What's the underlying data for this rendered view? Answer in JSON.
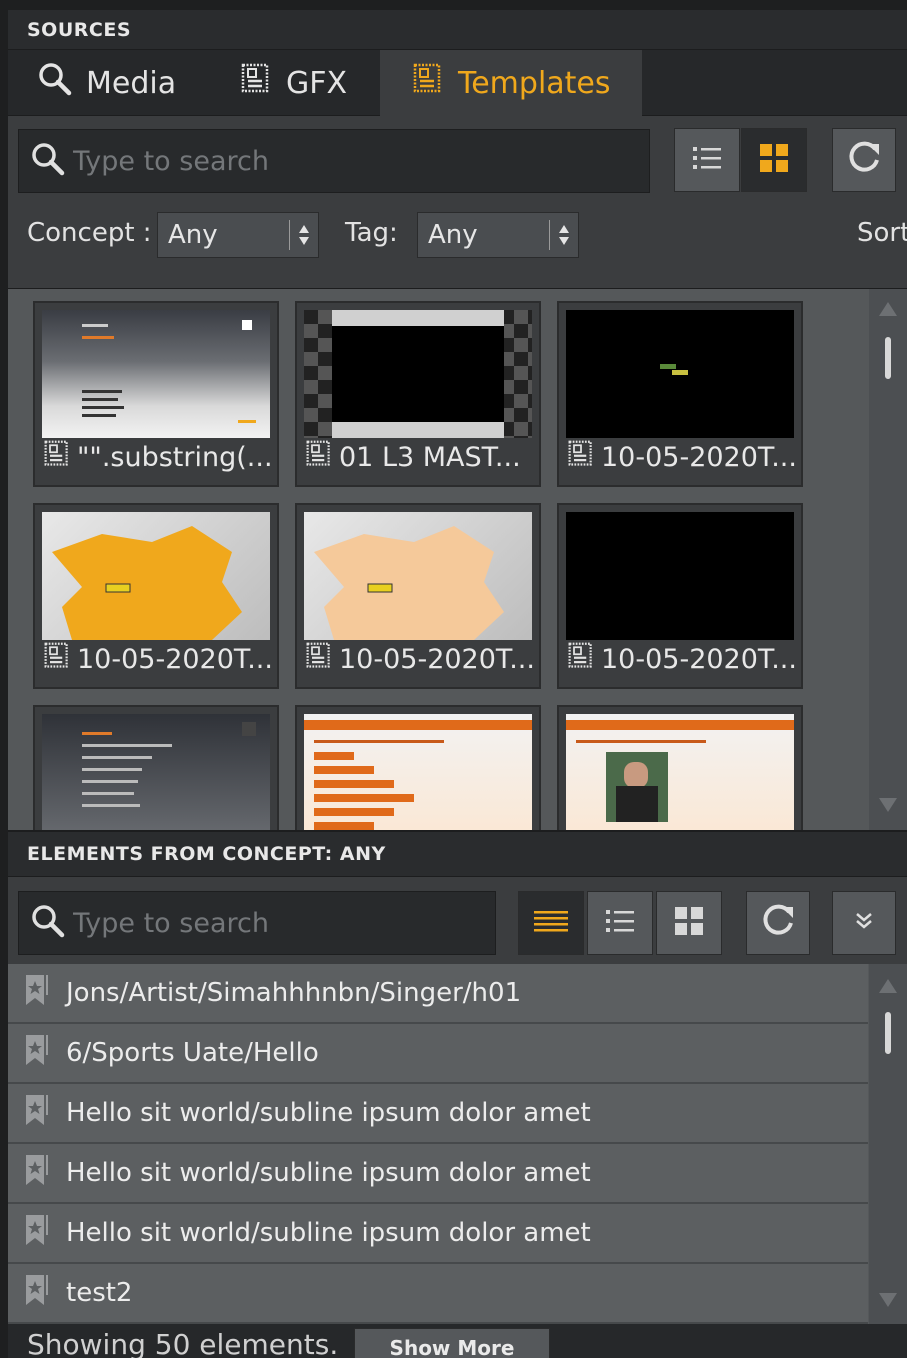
{
  "sources": {
    "header": "SOURCES",
    "tabs": [
      {
        "label": "Media",
        "icon": "search-icon"
      },
      {
        "label": "GFX",
        "icon": "gfx-icon"
      },
      {
        "label": "Templates",
        "icon": "template-icon",
        "active": true
      }
    ],
    "search_placeholder": "Type to search",
    "concept_label": "Concept :",
    "concept_value": "Any",
    "tag_label": "Tag:",
    "tag_value": "Any",
    "sort_label": "Sort",
    "templates": [
      {
        "caption": "\"\".substring(..."
      },
      {
        "caption": "01 L3 MAST..."
      },
      {
        "caption": "10-05-2020T..."
      },
      {
        "caption": "10-05-2020T..."
      },
      {
        "caption": "10-05-2020T..."
      },
      {
        "caption": "10-05-2020T..."
      },
      {
        "caption": ""
      },
      {
        "caption": ""
      },
      {
        "caption": ""
      }
    ]
  },
  "elements": {
    "header": "ELEMENTS FROM CONCEPT: ANY",
    "search_placeholder": "Type to search",
    "items": [
      "Jons/Artist/Simahhhnbn/Singer/h01",
      "6/Sports Uate/Hello",
      "Hello sit world/subline ipsum dolor amet",
      "Hello sit world/subline ipsum dolor amet",
      "Hello sit world/subline ipsum dolor amet",
      "test2"
    ],
    "footer_text": "Showing 50 elements.",
    "show_more": "Show More"
  },
  "colors": {
    "accent": "#f0a81c",
    "panel": "#3b3d3f",
    "grid_bg": "#55585a"
  }
}
